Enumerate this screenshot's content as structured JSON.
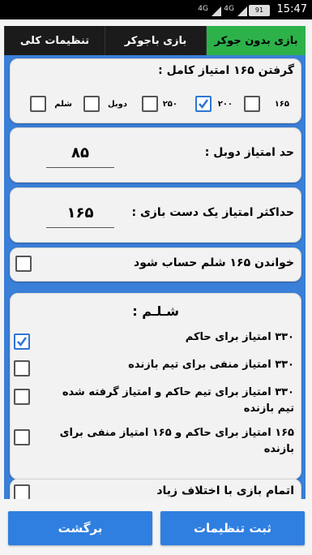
{
  "status": {
    "time": "15:47",
    "battery": "91",
    "sig1": "4G",
    "sig2": "4G"
  },
  "tabs": [
    {
      "label": "بازی بدون جوکر",
      "active": true
    },
    {
      "label": "بازی باجوکر",
      "active": false
    },
    {
      "label": "تنظیمات کلی",
      "active": false
    }
  ],
  "full_score": {
    "title": "گرفتن ۱۶۵ امتیاز کامل :",
    "options": [
      {
        "label": "۱۶۵",
        "checked": false
      },
      {
        "label": "۲۰۰",
        "checked": true
      },
      {
        "label": "۲۵۰",
        "checked": false
      },
      {
        "label": "دوبل",
        "checked": false
      },
      {
        "label": "شلم",
        "checked": false
      }
    ]
  },
  "double_limit": {
    "label": "حد امتیاز دوبل :",
    "value": "۸۵"
  },
  "max_one_hand": {
    "label": "حداکثر امتیاز یک دست بازی :",
    "value": "۱۶۵"
  },
  "shelem_call": {
    "label": "خواندن ۱۶۵ شلم حساب شود",
    "checked": false
  },
  "shelem": {
    "title": "شـلـم :",
    "options": [
      {
        "label": "۳۳۰ امتیاز برای حاکم",
        "checked": true
      },
      {
        "label": "۳۳۰ امتیاز منفی برای تیم بازنده",
        "checked": false
      },
      {
        "label": "۳۳۰ امتیاز برای تیم حاکم و امتیاز گرفته شده تیم بازنده",
        "checked": false
      },
      {
        "label": "۱۶۵ امتیاز برای حاکم و ۱۶۵ امتیاز منفی برای بازنده",
        "checked": false
      }
    ]
  },
  "end_game": {
    "label": "اتمام بازی با اختلاف زیاد",
    "checked": false
  },
  "buttons": {
    "save": "ثبت تنظیمات",
    "back": "برگشت"
  },
  "colors": {
    "accent": "#2f7fe0",
    "active_tab": "#2db24a",
    "background": "#3a7fd8"
  }
}
